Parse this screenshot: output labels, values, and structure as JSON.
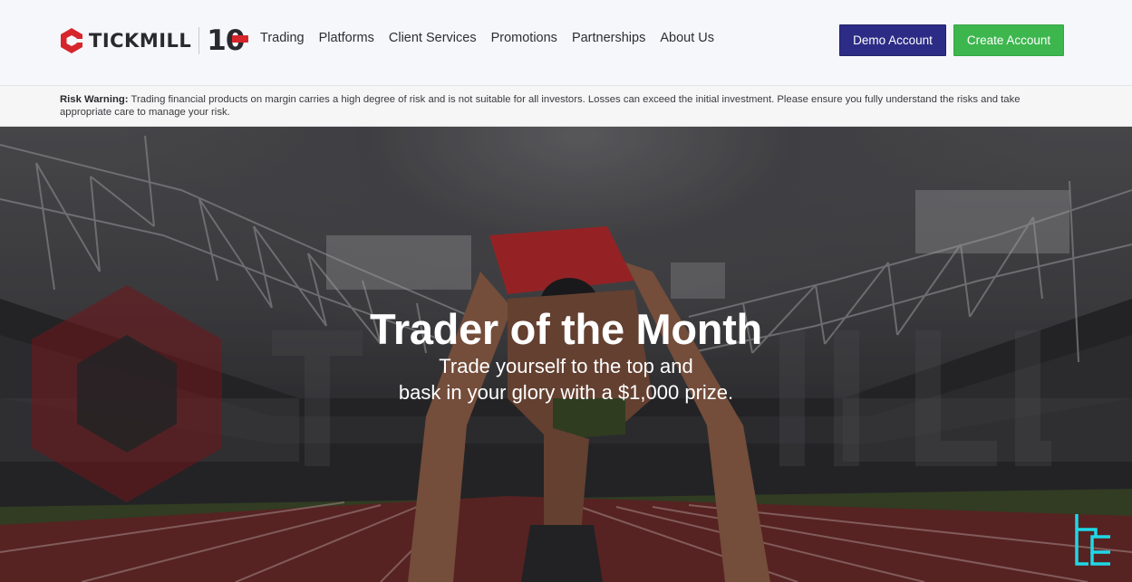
{
  "brand": {
    "name": "TICKMILL",
    "anniversary": "10",
    "accent_color": "#d6262c"
  },
  "nav": {
    "items": [
      {
        "label": "Trading"
      },
      {
        "label": "Platforms"
      },
      {
        "label": "Client Services"
      },
      {
        "label": "Promotions"
      },
      {
        "label": "Partnerships"
      },
      {
        "label": "About Us"
      }
    ]
  },
  "header": {
    "demo_label": "Demo Account",
    "demo_color": "#2c2c86",
    "create_label": "Create Account",
    "create_color": "#3db64e"
  },
  "risk_warning": {
    "label": "Risk Warning:",
    "text": " Trading financial products on margin carries a high degree of risk and is not suitable for all investors. Losses can exceed the initial investment. Please ensure you fully understand the risks and take appropriate care to manage your risk."
  },
  "hero": {
    "title": "Trader of the Month",
    "subtitle_line1": "Trade yourself to the top and",
    "subtitle_line2": "bask in your glory with a $1,000 prize.",
    "watermark": "TICKMILL"
  },
  "corner_logo": {
    "icon": "tc-logo-icon",
    "color": "#1fd8e6"
  }
}
